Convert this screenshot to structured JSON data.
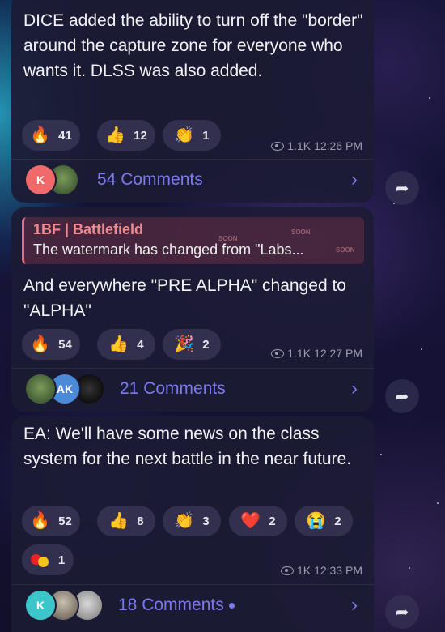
{
  "posts": [
    {
      "text": "DICE added the ability to turn off the \"border\" around the capture zone for everyone who wants it. DLSS was also added.",
      "reactions": [
        {
          "icon": "fire-icon",
          "emoji": "🔥",
          "count": "41"
        },
        {
          "icon": "thumbs-up-icon",
          "emoji": "👍",
          "count": "12"
        },
        {
          "icon": "clap-icon",
          "emoji": "👏",
          "count": "1"
        }
      ],
      "views": "1.1K",
      "time": "12:26 PM",
      "comments_label": "54 Comments",
      "avatars": [
        {
          "initial": "K",
          "color": "#f06a6a"
        },
        {
          "initial": "",
          "color": "#4d6b3a"
        }
      ]
    },
    {
      "quote_title": "1BF | Battlefield",
      "quote_text": "The watermark has changed from \"Labs...",
      "quote_bg_text": "SOON",
      "text": "And everywhere \"PRE ALPHA\" changed to \"ALPHA\"",
      "reactions": [
        {
          "icon": "fire-icon",
          "emoji": "🔥",
          "count": "54"
        },
        {
          "icon": "thumbs-up-icon",
          "emoji": "👍",
          "count": "4"
        },
        {
          "icon": "party-popper-icon",
          "emoji": "🎉",
          "count": "2"
        }
      ],
      "views": "1.1K",
      "time": "12:27 PM",
      "comments_label": "21 Comments",
      "avatars": [
        {
          "initial": "",
          "color": "#4d6b3a"
        },
        {
          "initial": "AK",
          "color": "#4a8ad8"
        },
        {
          "initial": "",
          "color": "#111"
        }
      ]
    },
    {
      "text": "EA: We'll have some news on the class system for the next battle in the near future.",
      "reactions": [
        {
          "icon": "fire-icon",
          "emoji": "🔥",
          "count": "52"
        },
        {
          "icon": "thumbs-up-icon",
          "emoji": "👍",
          "count": "8"
        },
        {
          "icon": "clap-icon",
          "emoji": "👏",
          "count": "3"
        },
        {
          "icon": "heart-icon",
          "emoji": "❤️",
          "count": "2"
        },
        {
          "icon": "crying-face-icon",
          "emoji": "😭",
          "count": "2"
        },
        {
          "icon": "red-yellow-dots-icon",
          "emoji": "🔴",
          "count": "1"
        }
      ],
      "views": "1K",
      "time": "12:33 PM",
      "comments_label": "18 Comments",
      "avatars": [
        {
          "initial": "K",
          "color": "#3cc6c9"
        },
        {
          "initial": "",
          "color": "#8a8378"
        },
        {
          "initial": "",
          "color": "#9a9a9a"
        }
      ]
    }
  ],
  "icons": {
    "chevron": "›",
    "share": "➦"
  },
  "colors": {
    "accent": "#7b79ee",
    "bubble": "#1c1b34",
    "quote_accent": "#e0707a"
  }
}
